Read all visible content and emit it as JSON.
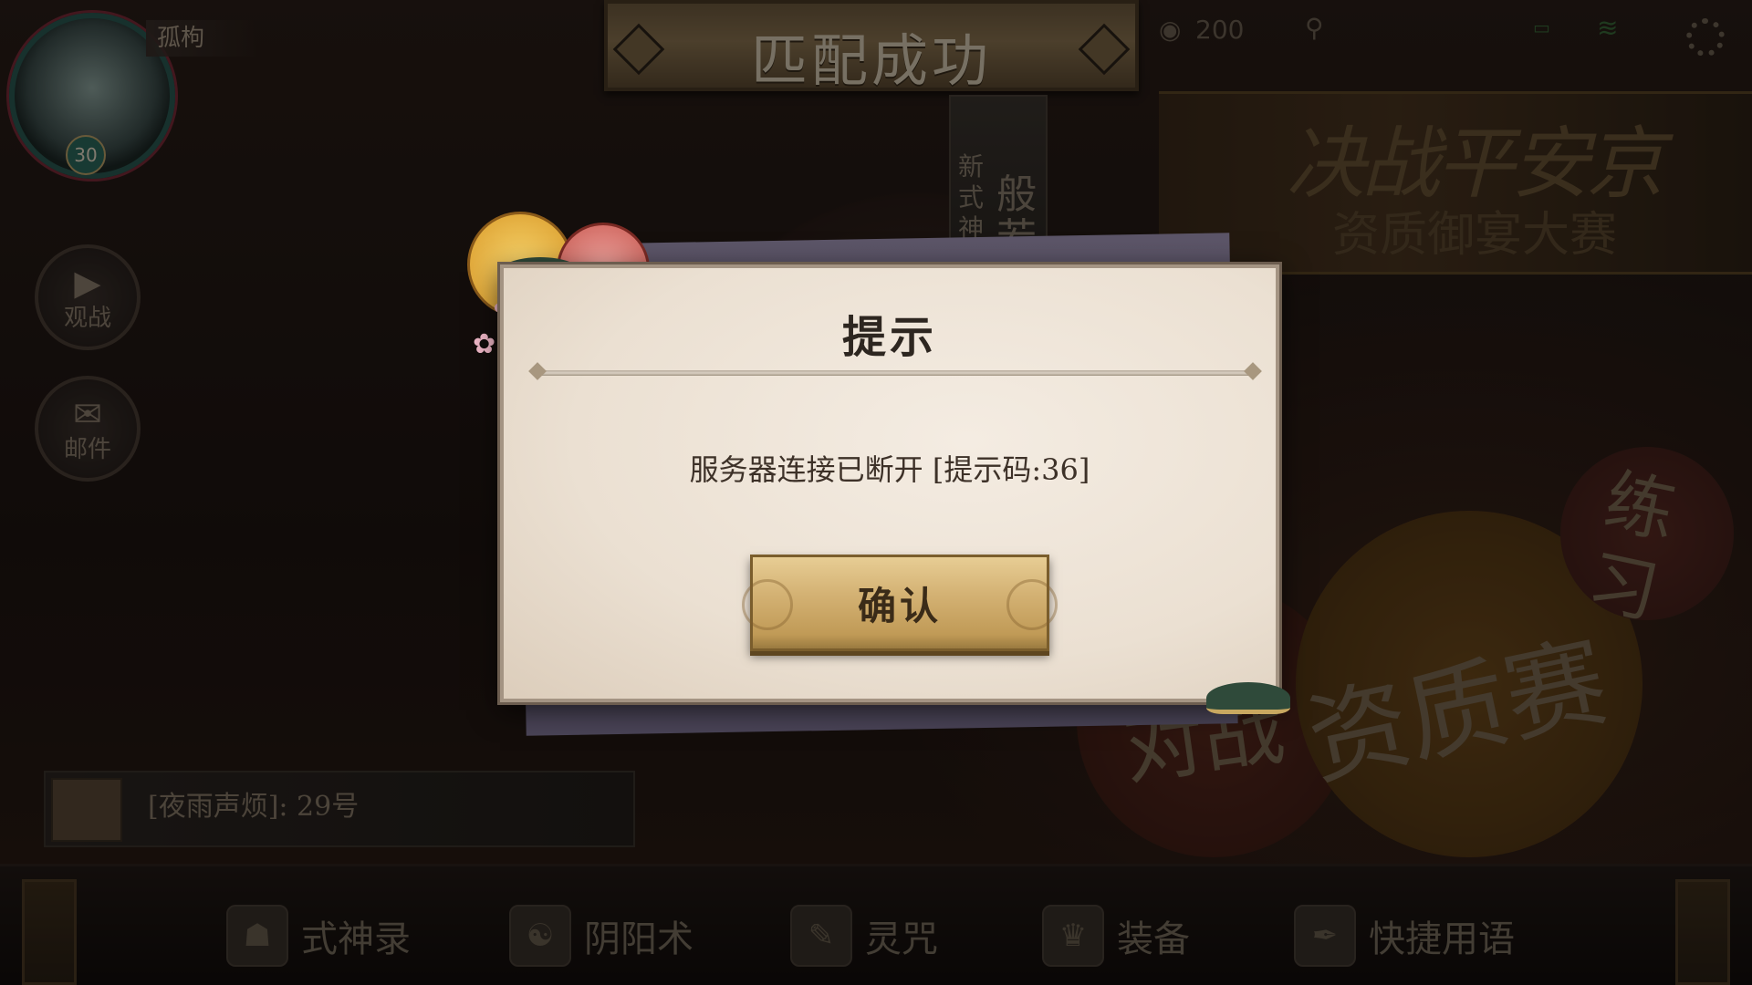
{
  "header": {
    "player_name": "孤枸",
    "level": "30",
    "title": "匹配成功",
    "coins": "200"
  },
  "side_buttons": [
    {
      "label": "观战",
      "icon": "play-icon"
    },
    {
      "label": "邮件",
      "icon": "mail-icon"
    }
  ],
  "new_shikigami": {
    "tag": "新式神",
    "name": "般若"
  },
  "event_banner": {
    "title": "决战平安京",
    "subtitle": "资质御宴大赛"
  },
  "modes": {
    "practice": "练习",
    "vs": "对战",
    "qualification": "资质赛"
  },
  "chat": {
    "message": "[夜雨声烦]: 29号"
  },
  "bottom_nav": [
    {
      "label": "式神录",
      "icon": "fox-mask-icon"
    },
    {
      "label": "阴阳术",
      "icon": "yinyang-icon"
    },
    {
      "label": "灵咒",
      "icon": "talisman-icon"
    },
    {
      "label": "装备",
      "icon": "helmet-icon"
    },
    {
      "label": "快捷用语",
      "icon": "brush-icon"
    }
  ],
  "dialog": {
    "title": "提示",
    "message": "服务器连接已断开 [提示码:36]",
    "confirm_label": "确认"
  },
  "colors": {
    "dialog_bg": "#efe6da",
    "button_gold": "#d4b274",
    "title_plate": "#8a7350"
  }
}
